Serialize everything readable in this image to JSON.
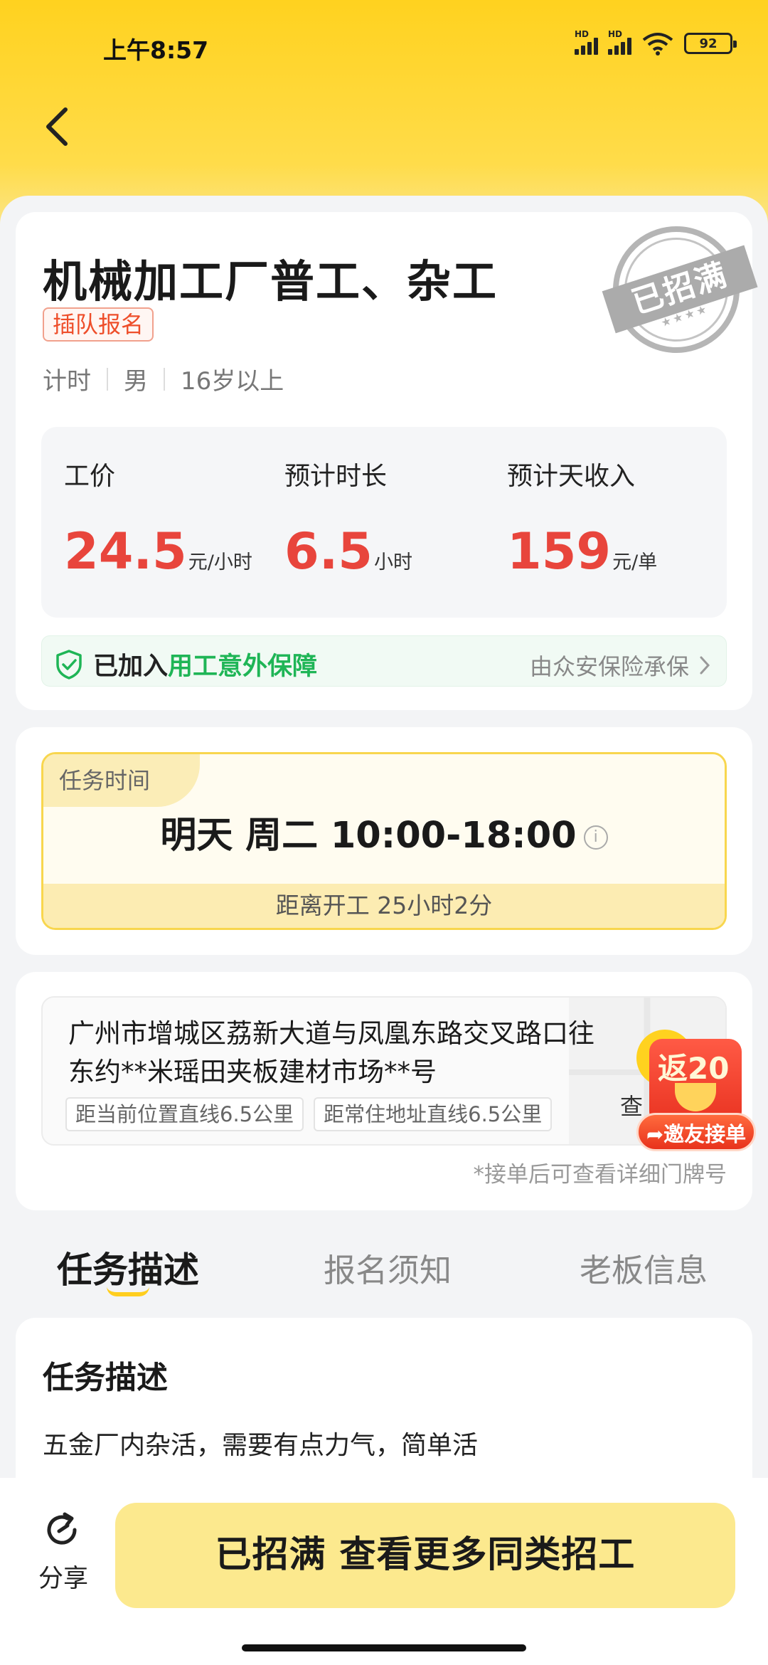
{
  "status_bar": {
    "time": "上午8:57",
    "battery": "92",
    "net_label_1": "HD",
    "net_label_2": "HD"
  },
  "header": {
    "back_icon": "chevron-left-icon"
  },
  "job": {
    "title": "机械加工厂普工、杂工",
    "tag": "插队报名",
    "meta": [
      "计时",
      "男",
      "16岁以上"
    ],
    "stamp_text": "已招满",
    "stamp_stars": "★★★★"
  },
  "pay": {
    "wage_label": "工价",
    "wage_value": "24.5",
    "wage_unit": "元/小时",
    "duration_label": "预计时长",
    "duration_value": "6.5",
    "duration_unit": "小时",
    "income_label": "预计天收入",
    "income_value": "159",
    "income_unit": "元/单"
  },
  "insurance": {
    "joined": "已加入",
    "name": "用工意外保障",
    "provider": "由众安保险承保"
  },
  "task_time": {
    "label": "任务时间",
    "value": "明天 周二 10:00-18:00",
    "countdown": "距离开工 25小时2分"
  },
  "address": {
    "text": "广州市增城区荔新大道与凤凰东路交叉路口往东约**米瑶田夹板建材市场**号",
    "distance_current": "距当前位置直线6.5公里",
    "distance_home": "距常住地址直线6.5公里",
    "view_map": "查",
    "note": "*接单后可查看详细门牌号"
  },
  "promo": {
    "title": "返20",
    "button": "邀友接单"
  },
  "tabs": [
    "任务描述",
    "报名须知",
    "老板信息"
  ],
  "description": {
    "title": "任务描述",
    "text": "五金厂内杂活，需要有点力气，简单活"
  },
  "bottom": {
    "share_label": "分享",
    "main_button": "已招满 查看更多同类招工"
  },
  "colors": {
    "brand_yellow": "#ffd21f",
    "price_red": "#e8453c",
    "insurance_green": "#1fb556"
  }
}
